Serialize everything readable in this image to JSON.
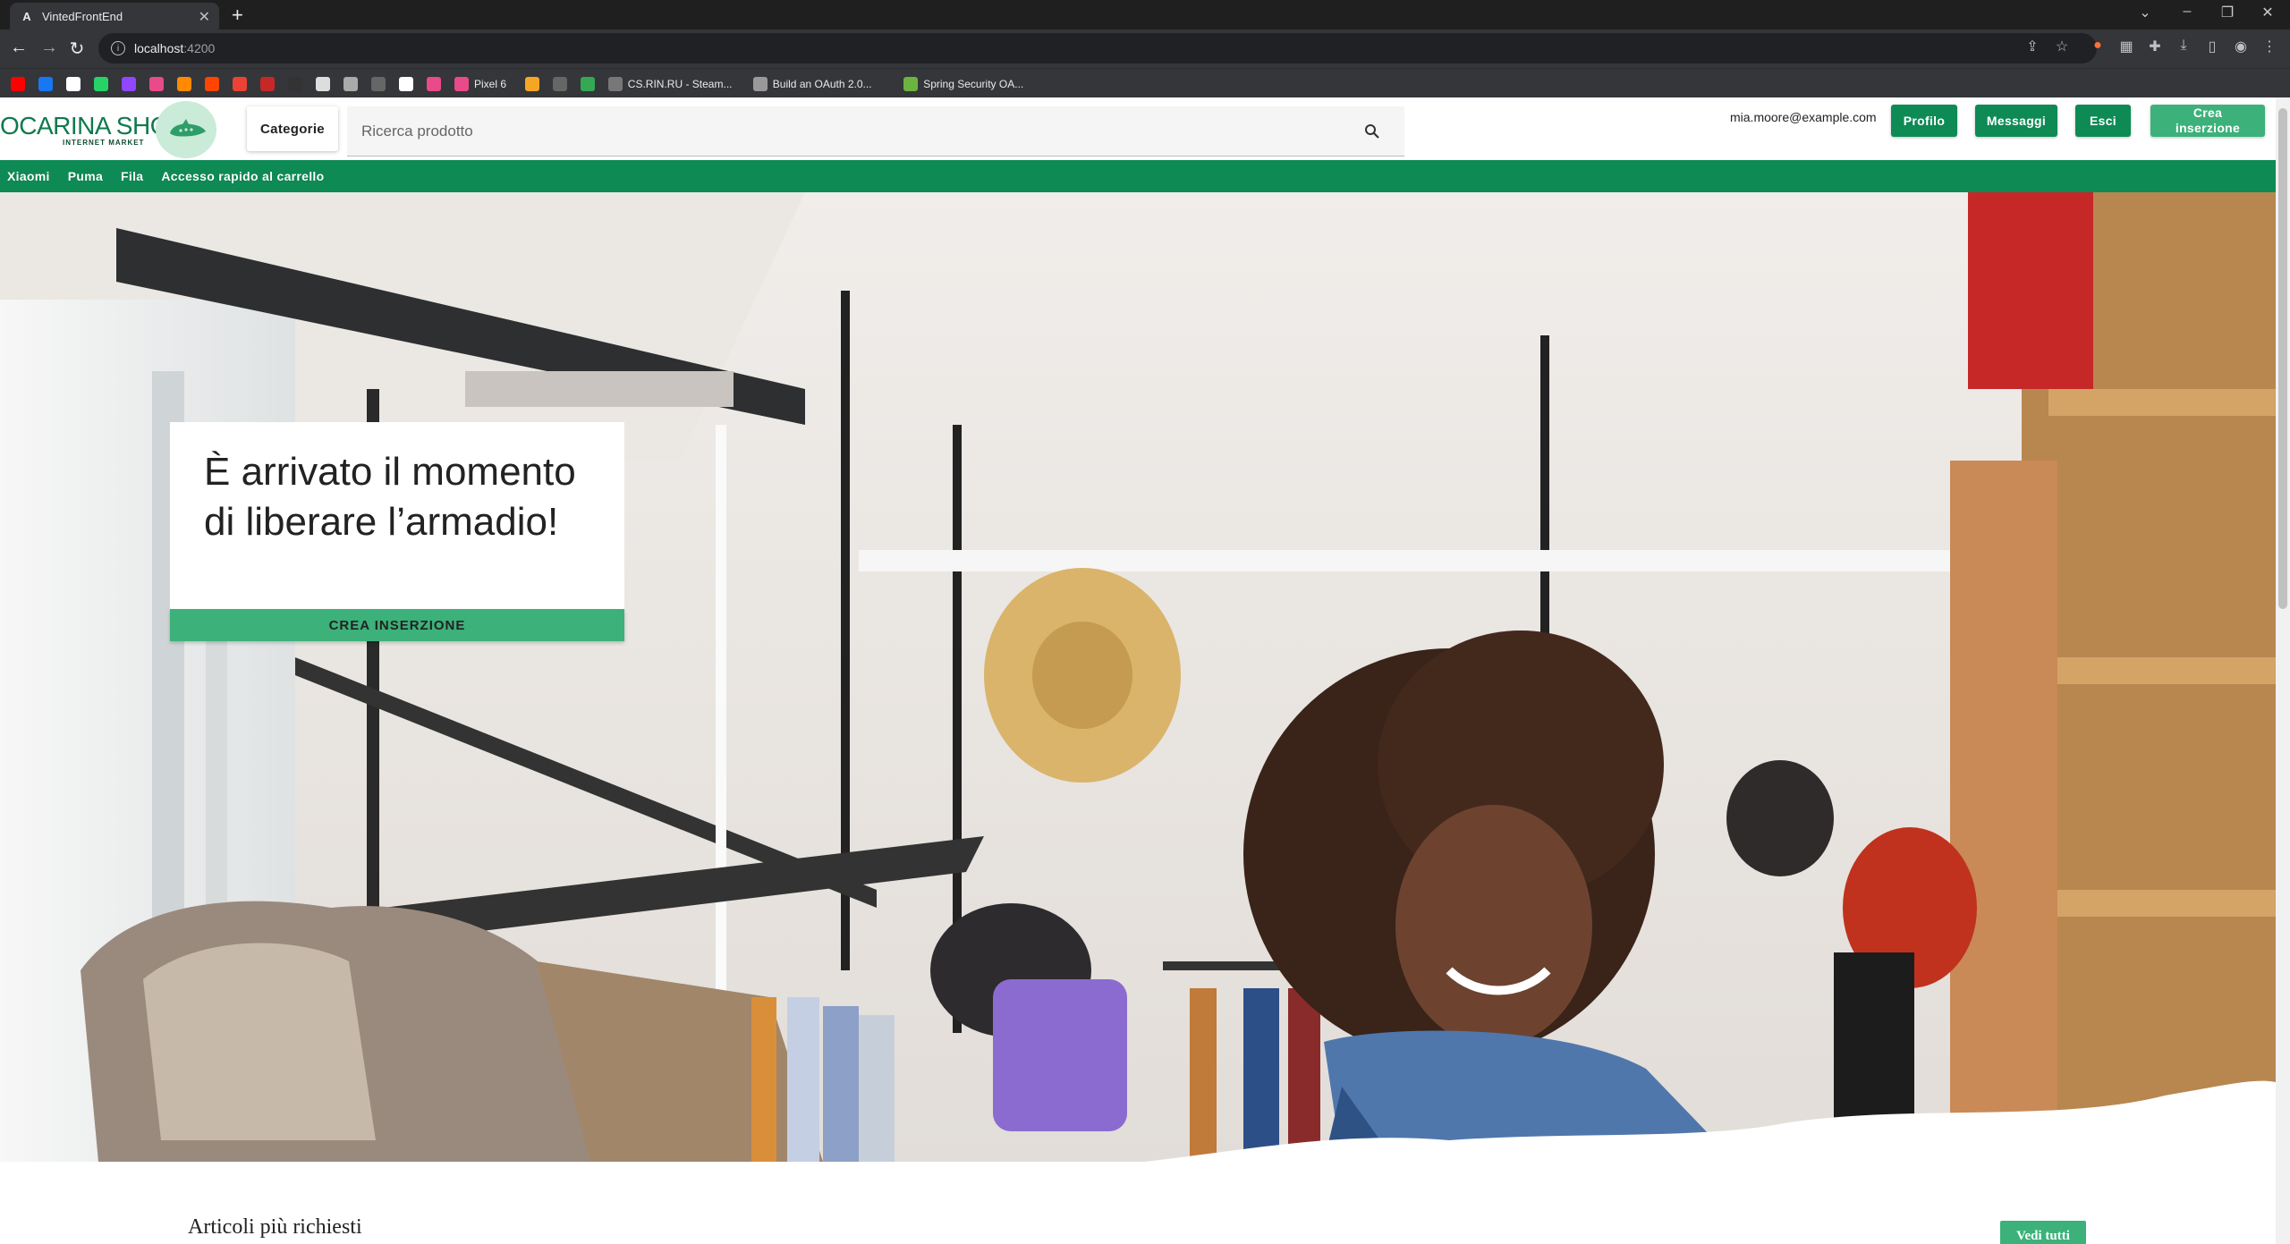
{
  "browser": {
    "tab_title": "VintedFrontEnd",
    "tab_favicon": "A",
    "url_host": "localhost",
    "url_port": ":4200",
    "bookmarks": [
      {
        "label": "",
        "icon": "youtube-icon",
        "color": "#ff0000"
      },
      {
        "label": "",
        "icon": "facebook-icon",
        "color": "#1877f2"
      },
      {
        "label": "",
        "icon": "amazon-icon",
        "color": "#ffffff"
      },
      {
        "label": "",
        "icon": "whatsapp-icon",
        "color": "#25d366"
      },
      {
        "label": "",
        "icon": "twitch-icon",
        "color": "#9146ff"
      },
      {
        "label": "",
        "icon": "bookmark-icon",
        "color": "#e84a8a"
      },
      {
        "label": "",
        "icon": "bookmark-icon",
        "color": "#ff8a00"
      },
      {
        "label": "",
        "icon": "reddit-icon",
        "color": "#ff4500"
      },
      {
        "label": "",
        "icon": "gmail-icon",
        "color": "#ea4335"
      },
      {
        "label": "",
        "icon": "bookmark-icon",
        "color": "#c62828"
      },
      {
        "label": "",
        "icon": "bookmark-icon",
        "color": "#333333"
      },
      {
        "label": "",
        "icon": "bookmark-icon",
        "color": "#dddddd"
      },
      {
        "label": "",
        "icon": "bookmark-icon",
        "color": "#aaaaaa"
      },
      {
        "label": "",
        "icon": "bookmark-icon",
        "color": "#666666"
      },
      {
        "label": "",
        "icon": "github-icon",
        "color": "#ffffff"
      },
      {
        "label": "",
        "icon": "bookmark-icon",
        "color": "#e84a8a"
      },
      {
        "label": "Pixel 6",
        "icon": "bookmark-icon",
        "color": "#e84a8a"
      },
      {
        "label": "",
        "icon": "bookmark-icon",
        "color": "#f5a623"
      },
      {
        "label": "",
        "icon": "bookmark-icon",
        "color": "#666666"
      },
      {
        "label": "",
        "icon": "drive-icon",
        "color": "#34a853"
      },
      {
        "label": "CS.RIN.RU - Steam...",
        "icon": "bookmark-icon",
        "color": "#777777"
      },
      {
        "label": "Build an OAuth 2.0...",
        "icon": "bookmark-icon",
        "color": "#999999"
      },
      {
        "label": "Spring Security OA...",
        "icon": "spring-icon",
        "color": "#6db33f"
      }
    ]
  },
  "header": {
    "logo_text": "OCARINA SHOP",
    "logo_sub": "INTERNET MARKET",
    "categories_label": "Categorie",
    "search_placeholder": "Ricerca prodotto",
    "user_email": "mia.moore@example.com",
    "profile_label": "Profilo",
    "messages_label": "Messaggi",
    "logout_label": "Esci",
    "create_label_line1": "Crea",
    "create_label_line2": "inserzione"
  },
  "nav": {
    "links": [
      "Xiaomi",
      "Puma",
      "Fila",
      "Accesso rapido al carrello"
    ]
  },
  "hero": {
    "title": "È arrivato il momento di liberare l’armadio!",
    "button_label": "CREA INSERZIONE"
  },
  "section": {
    "title": "Articoli più richiesti",
    "see_all_label": "Vedi tutti"
  },
  "colors": {
    "brand_green": "#0e8a55",
    "light_green": "#3cb17a"
  }
}
